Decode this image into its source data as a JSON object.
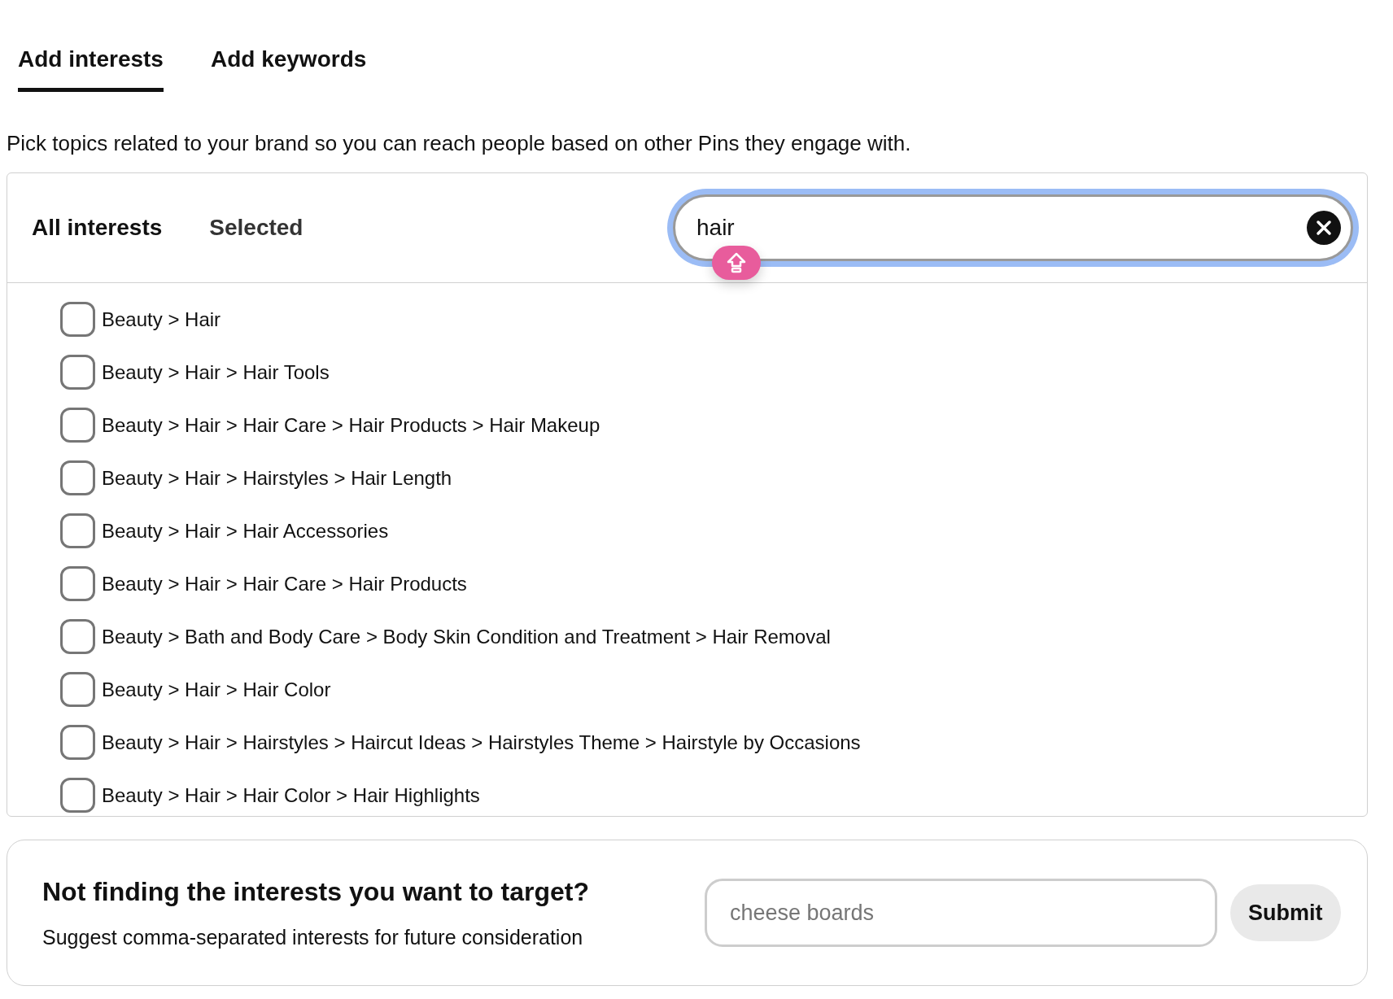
{
  "tabs": [
    {
      "label": "Add interests",
      "selected": true
    },
    {
      "label": "Add keywords",
      "selected": false
    }
  ],
  "description": "Pick topics related to your brand so you can reach people based on other Pins they engage with.",
  "filter_tabs": [
    {
      "label": "All interests",
      "selected": true
    },
    {
      "label": "Selected",
      "selected": false
    }
  ],
  "search": {
    "value": "hair"
  },
  "interests": [
    {
      "label": "Beauty > Hair",
      "checked": false
    },
    {
      "label": "Beauty > Hair > Hair Tools",
      "checked": false
    },
    {
      "label": "Beauty > Hair > Hair Care > Hair Products > Hair Makeup",
      "checked": false
    },
    {
      "label": "Beauty > Hair > Hairstyles > Hair Length",
      "checked": false
    },
    {
      "label": "Beauty > Hair > Hair Accessories",
      "checked": false
    },
    {
      "label": "Beauty > Hair > Hair Care > Hair Products",
      "checked": false
    },
    {
      "label": "Beauty > Bath and Body Care > Body Skin Condition and Treatment > Hair Removal",
      "checked": false
    },
    {
      "label": "Beauty > Hair > Hair Color",
      "checked": false
    },
    {
      "label": "Beauty > Hair > Hairstyles > Haircut Ideas > Hairstyles Theme > Hairstyle by Occasions",
      "checked": false
    },
    {
      "label": "Beauty > Hair > Hair Color > Hair Highlights",
      "checked": false
    }
  ],
  "suggest": {
    "title": "Not finding the interests you want to target?",
    "subtitle": "Suggest comma-separated interests for future consideration",
    "placeholder": "cheese boards",
    "button": "Submit"
  }
}
